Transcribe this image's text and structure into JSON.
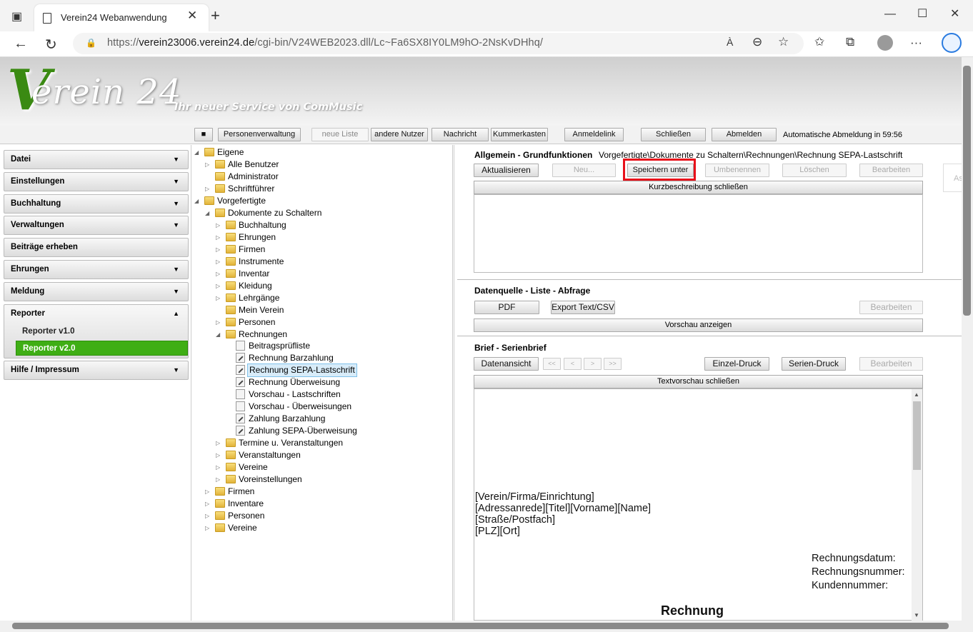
{
  "browser": {
    "tab_title": "Verein24 Webanwendung",
    "url_prefix": "https://",
    "url_host": "verein23006.verein24.de",
    "url_path": "/cgi-bin/V24WEB2023.dll/Lc~Fa6SX8IY0LM9hO-2NsKvDHhq/",
    "new_tab": "+",
    "close_tab": "✕",
    "back": "←",
    "reload": "↻",
    "lock": "🔒",
    "read_aloud": "À",
    "zoom": "⊖",
    "fav_add": "☆",
    "favorites": "✩",
    "collections": "⧉",
    "more": "···",
    "minimize": "—",
    "maximize": "☐",
    "close": "✕"
  },
  "header": {
    "logo_v": "V",
    "logo_rest": "erein 24",
    "tagline": "Ihr neuer Service von ComMusic"
  },
  "toolbar": {
    "menu": "■",
    "personenverwaltung": "Personenverwaltung",
    "neue_liste": "neue Liste",
    "andere_nutzer": "andere Nutzer",
    "nachricht": "Nachricht",
    "kummerkasten": "Kummerkasten",
    "anmeldelink": "Anmeldelink",
    "schliessen": "Schließen",
    "abmelden": "Abmelden",
    "auto_logout": "Automatische Abmeldung in 59:56"
  },
  "nav": {
    "items": [
      "Datei",
      "Einstellungen",
      "Buchhaltung",
      "Verwaltungen",
      "Beiträge erheben",
      "Ehrungen",
      "Meldung",
      "Reporter",
      "Hilfe / Impressum"
    ],
    "reporter_sub": [
      "Reporter v1.0",
      "Reporter v2.0"
    ],
    "caret_down": "▼",
    "caret_up": "▲"
  },
  "tree": {
    "nodes": [
      "Eigene",
      "Alle Benutzer",
      "Administrator",
      "Schriftführer",
      "Vorgefertigte",
      "Dokumente zu Schaltern",
      "Buchhaltung",
      "Ehrungen",
      "Firmen",
      "Instrumente",
      "Inventar",
      "Kleidung",
      "Lehrgänge",
      "Mein Verein",
      "Personen",
      "Rechnungen",
      "Beitragsprüfliste",
      "Rechnung Barzahlung",
      "Rechnung SEPA-Lastschrift",
      "Rechnung Überweisung",
      "Vorschau - Lastschriften",
      "Vorschau - Überweisungen",
      "Zahlung Barzahlung",
      "Zahlung SEPA-Überweisung",
      "Termine u. Veranstaltungen",
      "Veranstaltungen",
      "Vereine",
      "Voreinstellungen",
      "Firmen",
      "Inventare",
      "Personen",
      "Vereine"
    ]
  },
  "allgemein": {
    "title": "Allgemein - Grundfunktionen",
    "path": "Vorgefertigte\\Dokumente zu Schaltern\\Rechnungen\\Rechnung SEPA-Lastschrift",
    "aktualisieren": "Aktualisieren",
    "neu": "Neu...",
    "speichern_unter": "Speichern unter",
    "umbenennen": "Umbenennen",
    "loeschen": "Löschen",
    "bearbeiten": "Bearbeiten",
    "kurzbeschreibung": "Kurzbeschreibung schließen",
    "side": "As"
  },
  "datenquelle": {
    "title": "Datenquelle - Liste - Abfrage",
    "pdf": "PDF",
    "export": "Export Text/CSV",
    "bearbeiten": "Bearbeiten",
    "vorschau": "Vorschau anzeigen"
  },
  "brief": {
    "title": "Brief - Serienbrief",
    "datenansicht": "Datenansicht",
    "first": "<<",
    "prev": "<",
    "next": ">",
    "last": ">>",
    "einzel": "Einzel-Druck",
    "serien": "Serien-Druck",
    "bearbeiten": "Bearbeiten",
    "textvorschau": "Textvorschau schließen"
  },
  "document": {
    "lines": [
      "[Verein/Firma/Einrichtung]",
      "[Adressanrede][Titel][Vorname][Name]",
      "[Straße/Postfach]",
      "[PLZ][Ort]"
    ],
    "meta": [
      "Rechnungsdatum:",
      "Rechnungsnummer:",
      "Kundennummer:"
    ],
    "heading": "Rechnung"
  },
  "colors": {
    "accent_green": "#3fae15",
    "highlight_red": "#e8101a"
  }
}
